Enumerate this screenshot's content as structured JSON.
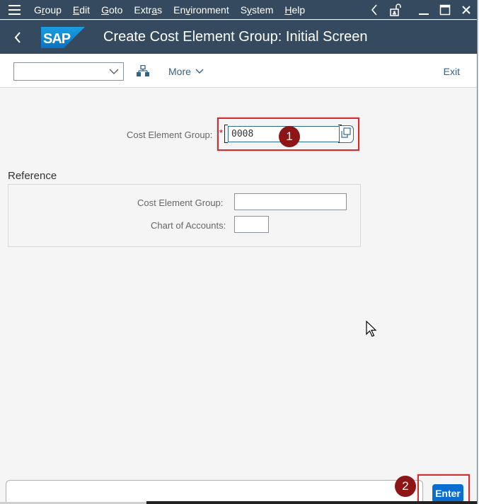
{
  "menubar": {
    "items": [
      {
        "label": "Group",
        "mnemonic_index": 1
      },
      {
        "label": "Edit",
        "mnemonic_index": 0
      },
      {
        "label": "Goto",
        "mnemonic_index": 0
      },
      {
        "label": "Extras",
        "mnemonic_index": 4
      },
      {
        "label": "Environment",
        "mnemonic_index": 2
      },
      {
        "label": "System",
        "mnemonic_index": 1
      },
      {
        "label": "Help",
        "mnemonic_index": 0
      }
    ],
    "icons": [
      "hamburger-menu-icon",
      "chevron-left-icon",
      "unlock-icon",
      "minimize-icon",
      "maximize-icon",
      "close-icon"
    ]
  },
  "shell": {
    "logo_text": "SAP",
    "title": "Create Cost Element Group: Initial Screen"
  },
  "toolbar": {
    "select_value": "",
    "more_label": "More",
    "exit_label": "Exit"
  },
  "form": {
    "cost_element_group_label": "Cost Element Group:",
    "cost_element_group_value": "0008",
    "required_marker": "*"
  },
  "reference": {
    "title": "Reference",
    "cost_element_group_label": "Cost Element Group:",
    "cost_element_group_value": "",
    "chart_of_accounts_label": "Chart of Accounts:",
    "chart_of_accounts_value": ""
  },
  "annotations": {
    "step1": "1",
    "step2": "2"
  },
  "footer": {
    "command_value": "",
    "enter_label": "Enter"
  },
  "colors": {
    "shell_bg": "#354a5f",
    "accent": "#0a6ed1",
    "annotation_red": "#d12f2f",
    "badge_red": "#8e1515"
  }
}
